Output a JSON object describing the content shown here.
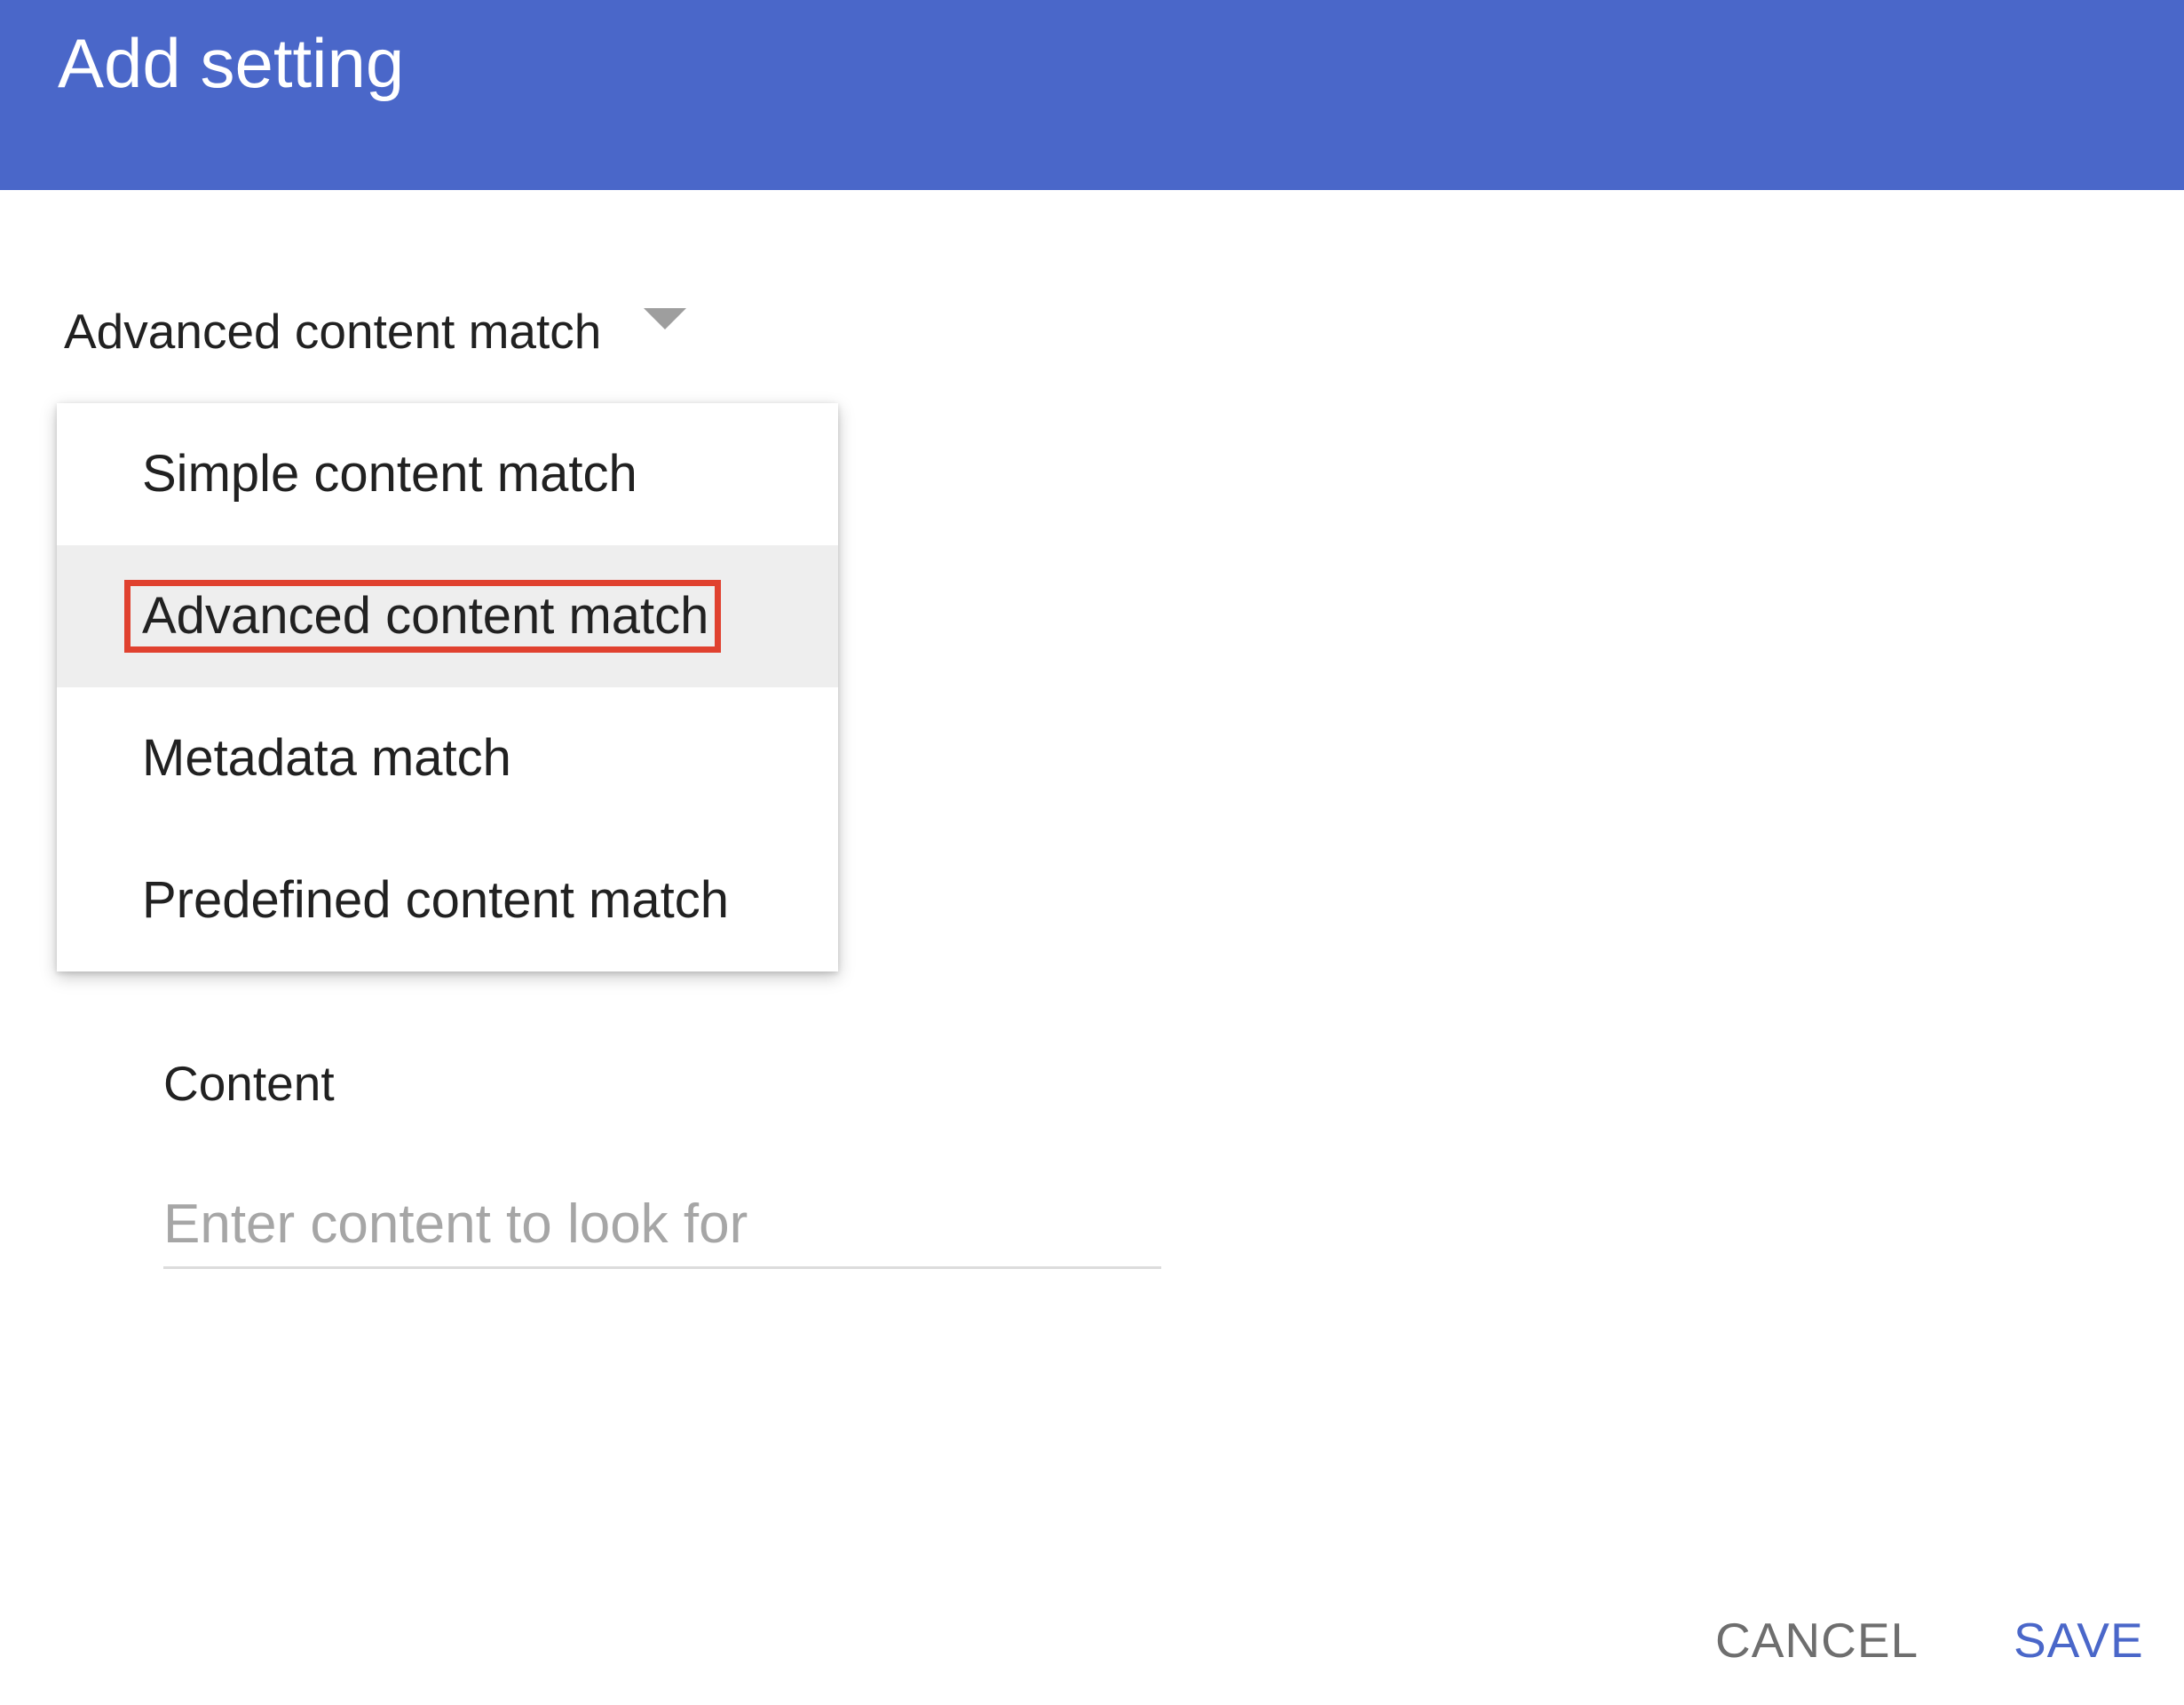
{
  "header": {
    "title": "Add setting",
    "color": "#4a67c9"
  },
  "match_type": {
    "selected_value": "Advanced content match",
    "caret_icon": "arrow-drop-down-icon",
    "options": [
      {
        "label": "Simple content match"
      },
      {
        "label": "Advanced content match"
      },
      {
        "label": "Metadata match"
      },
      {
        "label": "Predefined content match"
      }
    ],
    "highlighted_index": 1,
    "highlight_color": "#e0412f"
  },
  "content_field": {
    "label": "Content",
    "value": "",
    "placeholder": "Enter content to look for"
  },
  "actions": {
    "cancel_label": "CANCEL",
    "save_label": "SAVE"
  }
}
